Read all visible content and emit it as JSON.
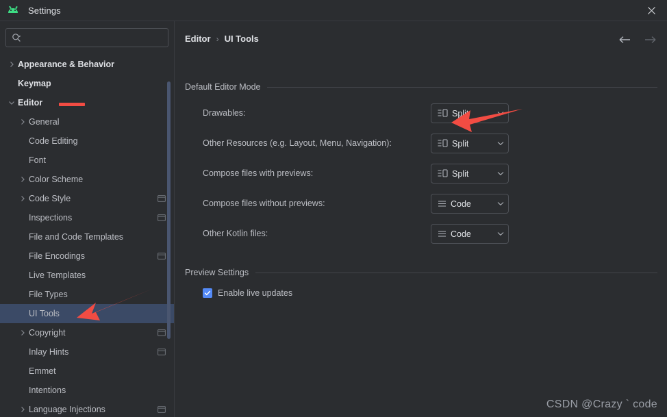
{
  "window": {
    "title": "Settings",
    "app_icon": "android-icon",
    "close_label": "×"
  },
  "sidebar": {
    "search": {
      "placeholder": "",
      "value": "",
      "icon": "search-icon"
    },
    "items": [
      {
        "label": "Appearance & Behavior",
        "indent": 0,
        "chevron": "right",
        "bold": true,
        "selected": false,
        "project_icon": false
      },
      {
        "label": "Keymap",
        "indent": 0,
        "chevron": "none",
        "bold": true,
        "selected": false,
        "project_icon": false
      },
      {
        "label": "Editor",
        "indent": 0,
        "chevron": "down",
        "bold": true,
        "selected": false,
        "project_icon": false
      },
      {
        "label": "General",
        "indent": 1,
        "chevron": "right",
        "bold": false,
        "selected": false,
        "project_icon": false
      },
      {
        "label": "Code Editing",
        "indent": 1,
        "chevron": "none",
        "bold": false,
        "selected": false,
        "project_icon": false
      },
      {
        "label": "Font",
        "indent": 1,
        "chevron": "none",
        "bold": false,
        "selected": false,
        "project_icon": false
      },
      {
        "label": "Color Scheme",
        "indent": 1,
        "chevron": "right",
        "bold": false,
        "selected": false,
        "project_icon": false
      },
      {
        "label": "Code Style",
        "indent": 1,
        "chevron": "right",
        "bold": false,
        "selected": false,
        "project_icon": true
      },
      {
        "label": "Inspections",
        "indent": 1,
        "chevron": "none",
        "bold": false,
        "selected": false,
        "project_icon": true
      },
      {
        "label": "File and Code Templates",
        "indent": 1,
        "chevron": "none",
        "bold": false,
        "selected": false,
        "project_icon": false
      },
      {
        "label": "File Encodings",
        "indent": 1,
        "chevron": "none",
        "bold": false,
        "selected": false,
        "project_icon": true
      },
      {
        "label": "Live Templates",
        "indent": 1,
        "chevron": "none",
        "bold": false,
        "selected": false,
        "project_icon": false
      },
      {
        "label": "File Types",
        "indent": 1,
        "chevron": "none",
        "bold": false,
        "selected": false,
        "project_icon": false
      },
      {
        "label": "UI Tools",
        "indent": 1,
        "chevron": "none",
        "bold": false,
        "selected": true,
        "project_icon": false
      },
      {
        "label": "Copyright",
        "indent": 1,
        "chevron": "right",
        "bold": false,
        "selected": false,
        "project_icon": true
      },
      {
        "label": "Inlay Hints",
        "indent": 1,
        "chevron": "none",
        "bold": false,
        "selected": false,
        "project_icon": true
      },
      {
        "label": "Emmet",
        "indent": 1,
        "chevron": "none",
        "bold": false,
        "selected": false,
        "project_icon": false
      },
      {
        "label": "Intentions",
        "indent": 1,
        "chevron": "none",
        "bold": false,
        "selected": false,
        "project_icon": false
      },
      {
        "label": "Language Injections",
        "indent": 1,
        "chevron": "right",
        "bold": false,
        "selected": false,
        "project_icon": true
      }
    ]
  },
  "main": {
    "breadcrumb": {
      "root": "Editor",
      "separator": "›",
      "current": "UI Tools"
    },
    "nav": {
      "back_icon": "arrow-left-icon",
      "forward_icon": "arrow-right-icon"
    },
    "sections": [
      {
        "title": "Default Editor Mode"
      },
      {
        "title": "Preview Settings"
      }
    ],
    "editor_mode_rows": [
      {
        "label": "Drawables:",
        "value": "Split",
        "icon": "split-view-icon"
      },
      {
        "label": "Other Resources (e.g. Layout, Menu, Navigation):",
        "value": "Split",
        "icon": "split-view-icon"
      },
      {
        "label": "Compose files with previews:",
        "value": "Split",
        "icon": "split-view-icon"
      },
      {
        "label": "Compose files without previews:",
        "value": "Code",
        "icon": "code-view-icon"
      },
      {
        "label": "Other Kotlin files:",
        "value": "Code",
        "icon": "code-view-icon"
      }
    ],
    "preview_settings": {
      "live_updates_label": "Enable live updates",
      "live_updates_checked": true
    }
  },
  "watermark": {
    "text": "CSDN @Crazy ` code"
  },
  "colors": {
    "background": "#2b2d30",
    "selection": "#3b4a66",
    "accent": "#548af7",
    "annotation_red": "#f24c43",
    "text_primary": "#dfe1e5",
    "text_secondary": "#bcbec4"
  }
}
